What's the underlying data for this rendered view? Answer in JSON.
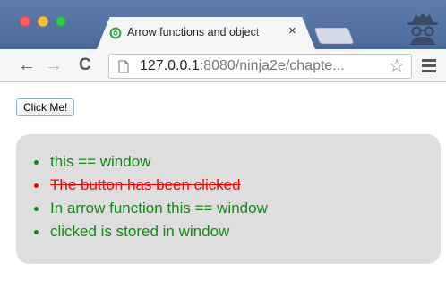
{
  "browser": {
    "tab": {
      "title": "Arrow functions and object",
      "close": "×"
    },
    "nav": {
      "back": "←",
      "forward": "→",
      "reload": "C"
    },
    "address": {
      "host": "127.0.0.1",
      "rest": ":8080/ninja2e/chapte..."
    },
    "star": "☆"
  },
  "page": {
    "button_label": "Click Me!",
    "results": [
      {
        "text": "this == window",
        "status": "pass"
      },
      {
        "text": "The button has been clicked",
        "status": "fail"
      },
      {
        "text": "In arrow function this == window",
        "status": "pass"
      },
      {
        "text": "clicked is stored in window",
        "status": "pass"
      }
    ]
  },
  "colors": {
    "pass": "#118c11",
    "fail": "#ff0000",
    "chrome_frame": "#4b6a9c",
    "results_bg": "#dedede"
  }
}
